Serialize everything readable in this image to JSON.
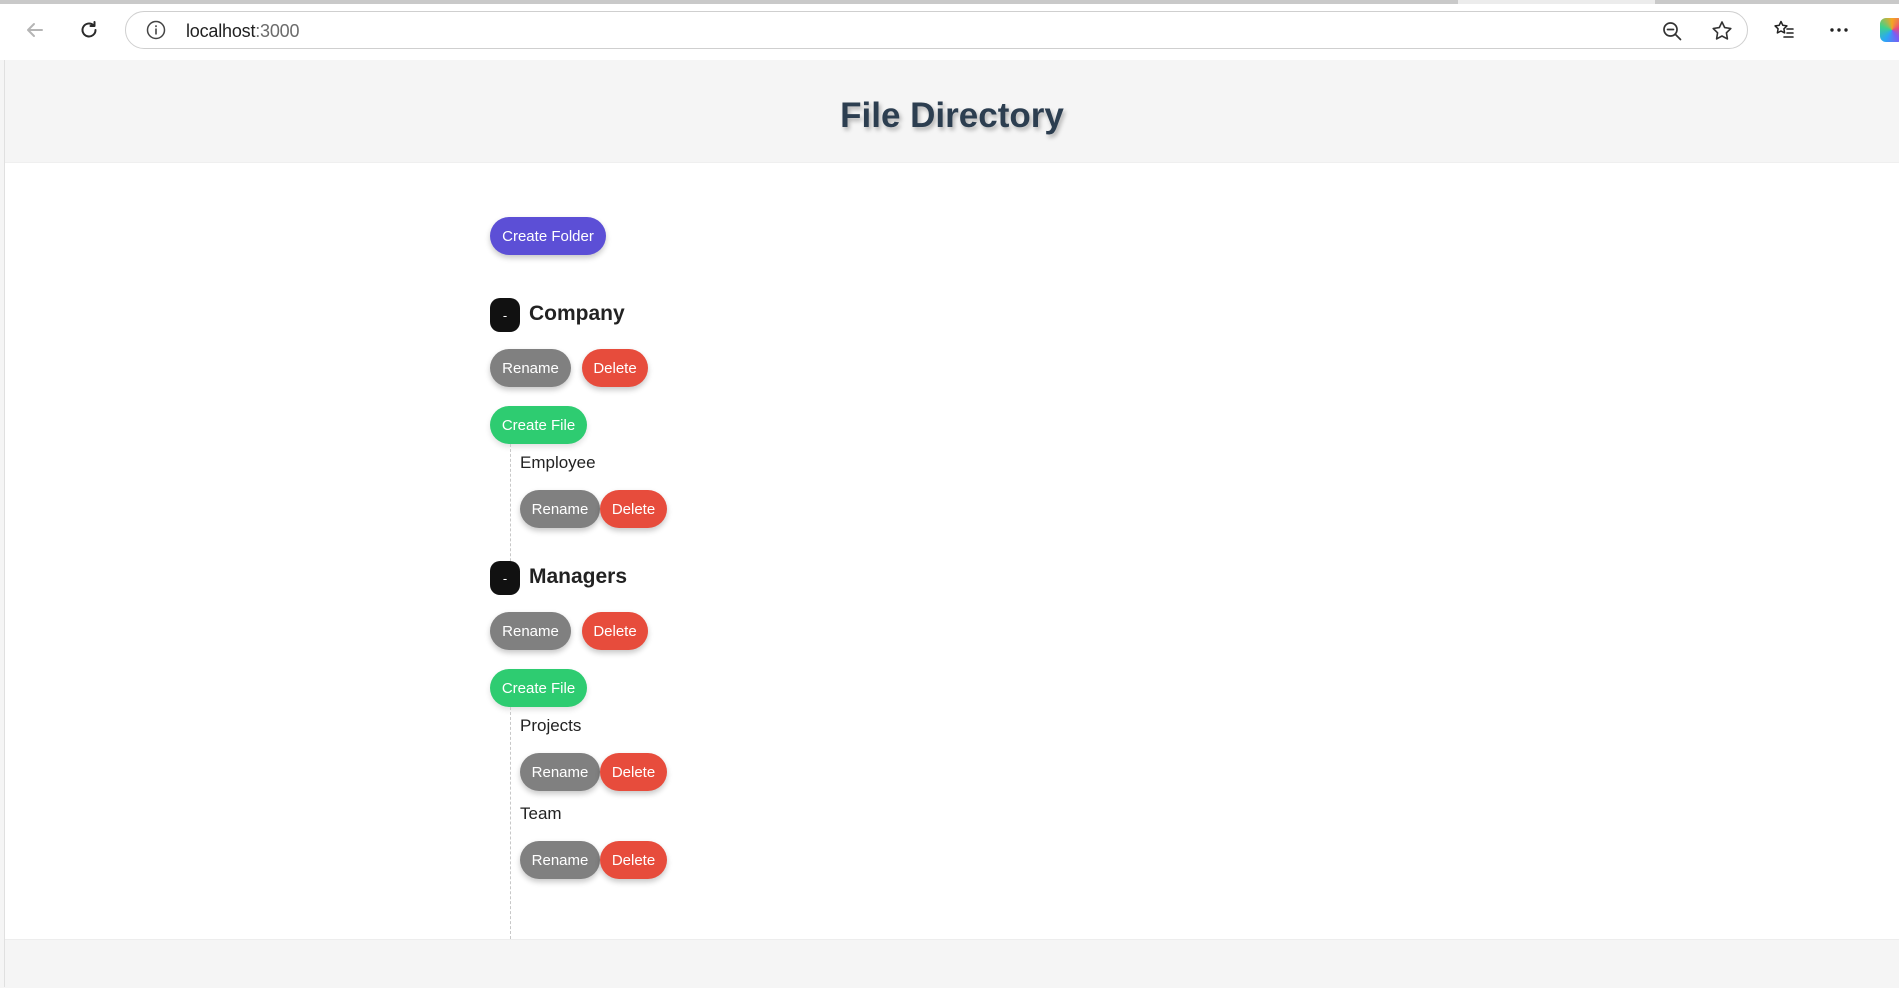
{
  "browser": {
    "url_host": "localhost",
    "url_port": ":3000",
    "icons": {
      "back": "back-arrow-icon",
      "reload": "reload-icon",
      "info": "info-icon",
      "zoom": "zoom-out-icon",
      "favorite": "star-icon",
      "favorites": "favorites-list-icon",
      "menu": "more-icon",
      "copilot": "copilot-icon"
    }
  },
  "page": {
    "title": "File Directory",
    "create_folder_label": "Create Folder"
  },
  "folders": [
    {
      "toggle_label": "-",
      "name": "Company",
      "rename_label": "Rename",
      "delete_label": "Delete",
      "create_file_label": "Create File",
      "files": [
        {
          "name": "Employee",
          "rename_label": "Rename",
          "delete_label": "Delete"
        }
      ]
    },
    {
      "toggle_label": "-",
      "name": "Managers",
      "rename_label": "Rename",
      "delete_label": "Delete",
      "create_file_label": "Create File",
      "files": [
        {
          "name": "Projects",
          "rename_label": "Rename",
          "delete_label": "Delete"
        },
        {
          "name": "Team",
          "rename_label": "Rename",
          "delete_label": "Delete"
        }
      ]
    }
  ],
  "colors": {
    "create_folder": "#5c4fd6",
    "rename": "#808080",
    "delete": "#e74c3c",
    "create_file": "#2ecc71",
    "title": "#2c3e50"
  }
}
